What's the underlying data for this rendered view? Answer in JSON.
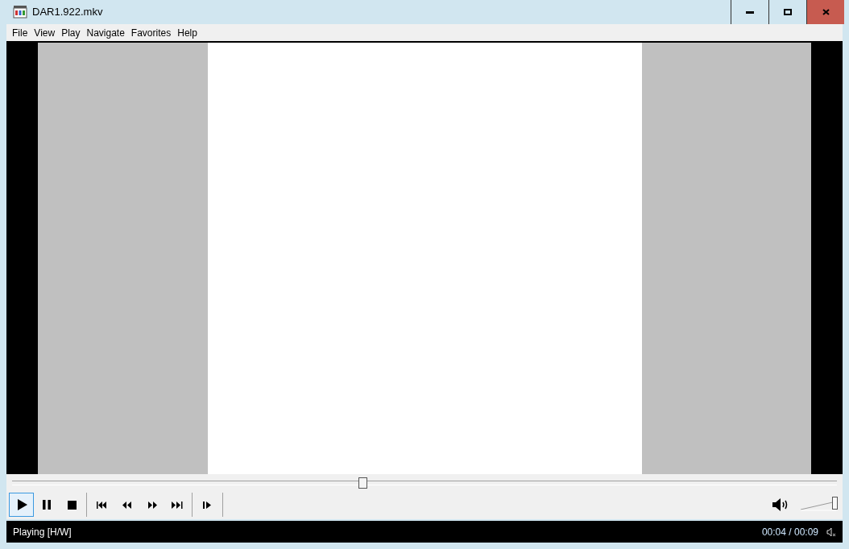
{
  "window": {
    "title": "DAR1.922.mkv",
    "buttons": [
      {
        "kind": "minimize"
      },
      {
        "kind": "maximize"
      },
      {
        "kind": "close"
      }
    ]
  },
  "menu": [
    "File",
    "View",
    "Play",
    "Navigate",
    "Favorites",
    "Help"
  ],
  "seek": {
    "level": 0.425
  },
  "controls": [
    {
      "kind": "play",
      "selected": true
    },
    {
      "kind": "pause",
      "selected": false
    },
    {
      "kind": "stop",
      "selected": false
    },
    {
      "kind": "sep"
    },
    {
      "kind": "prev",
      "selected": false
    },
    {
      "kind": "rewind",
      "selected": false
    },
    {
      "kind": "forward",
      "selected": false
    },
    {
      "kind": "next",
      "selected": false
    },
    {
      "kind": "sep"
    },
    {
      "kind": "step",
      "selected": false
    },
    {
      "kind": "sep"
    }
  ],
  "volume": {
    "level": 1
  },
  "status_bar": {
    "status": "Playing [H/W]",
    "time": "00:04 / 00:09"
  }
}
